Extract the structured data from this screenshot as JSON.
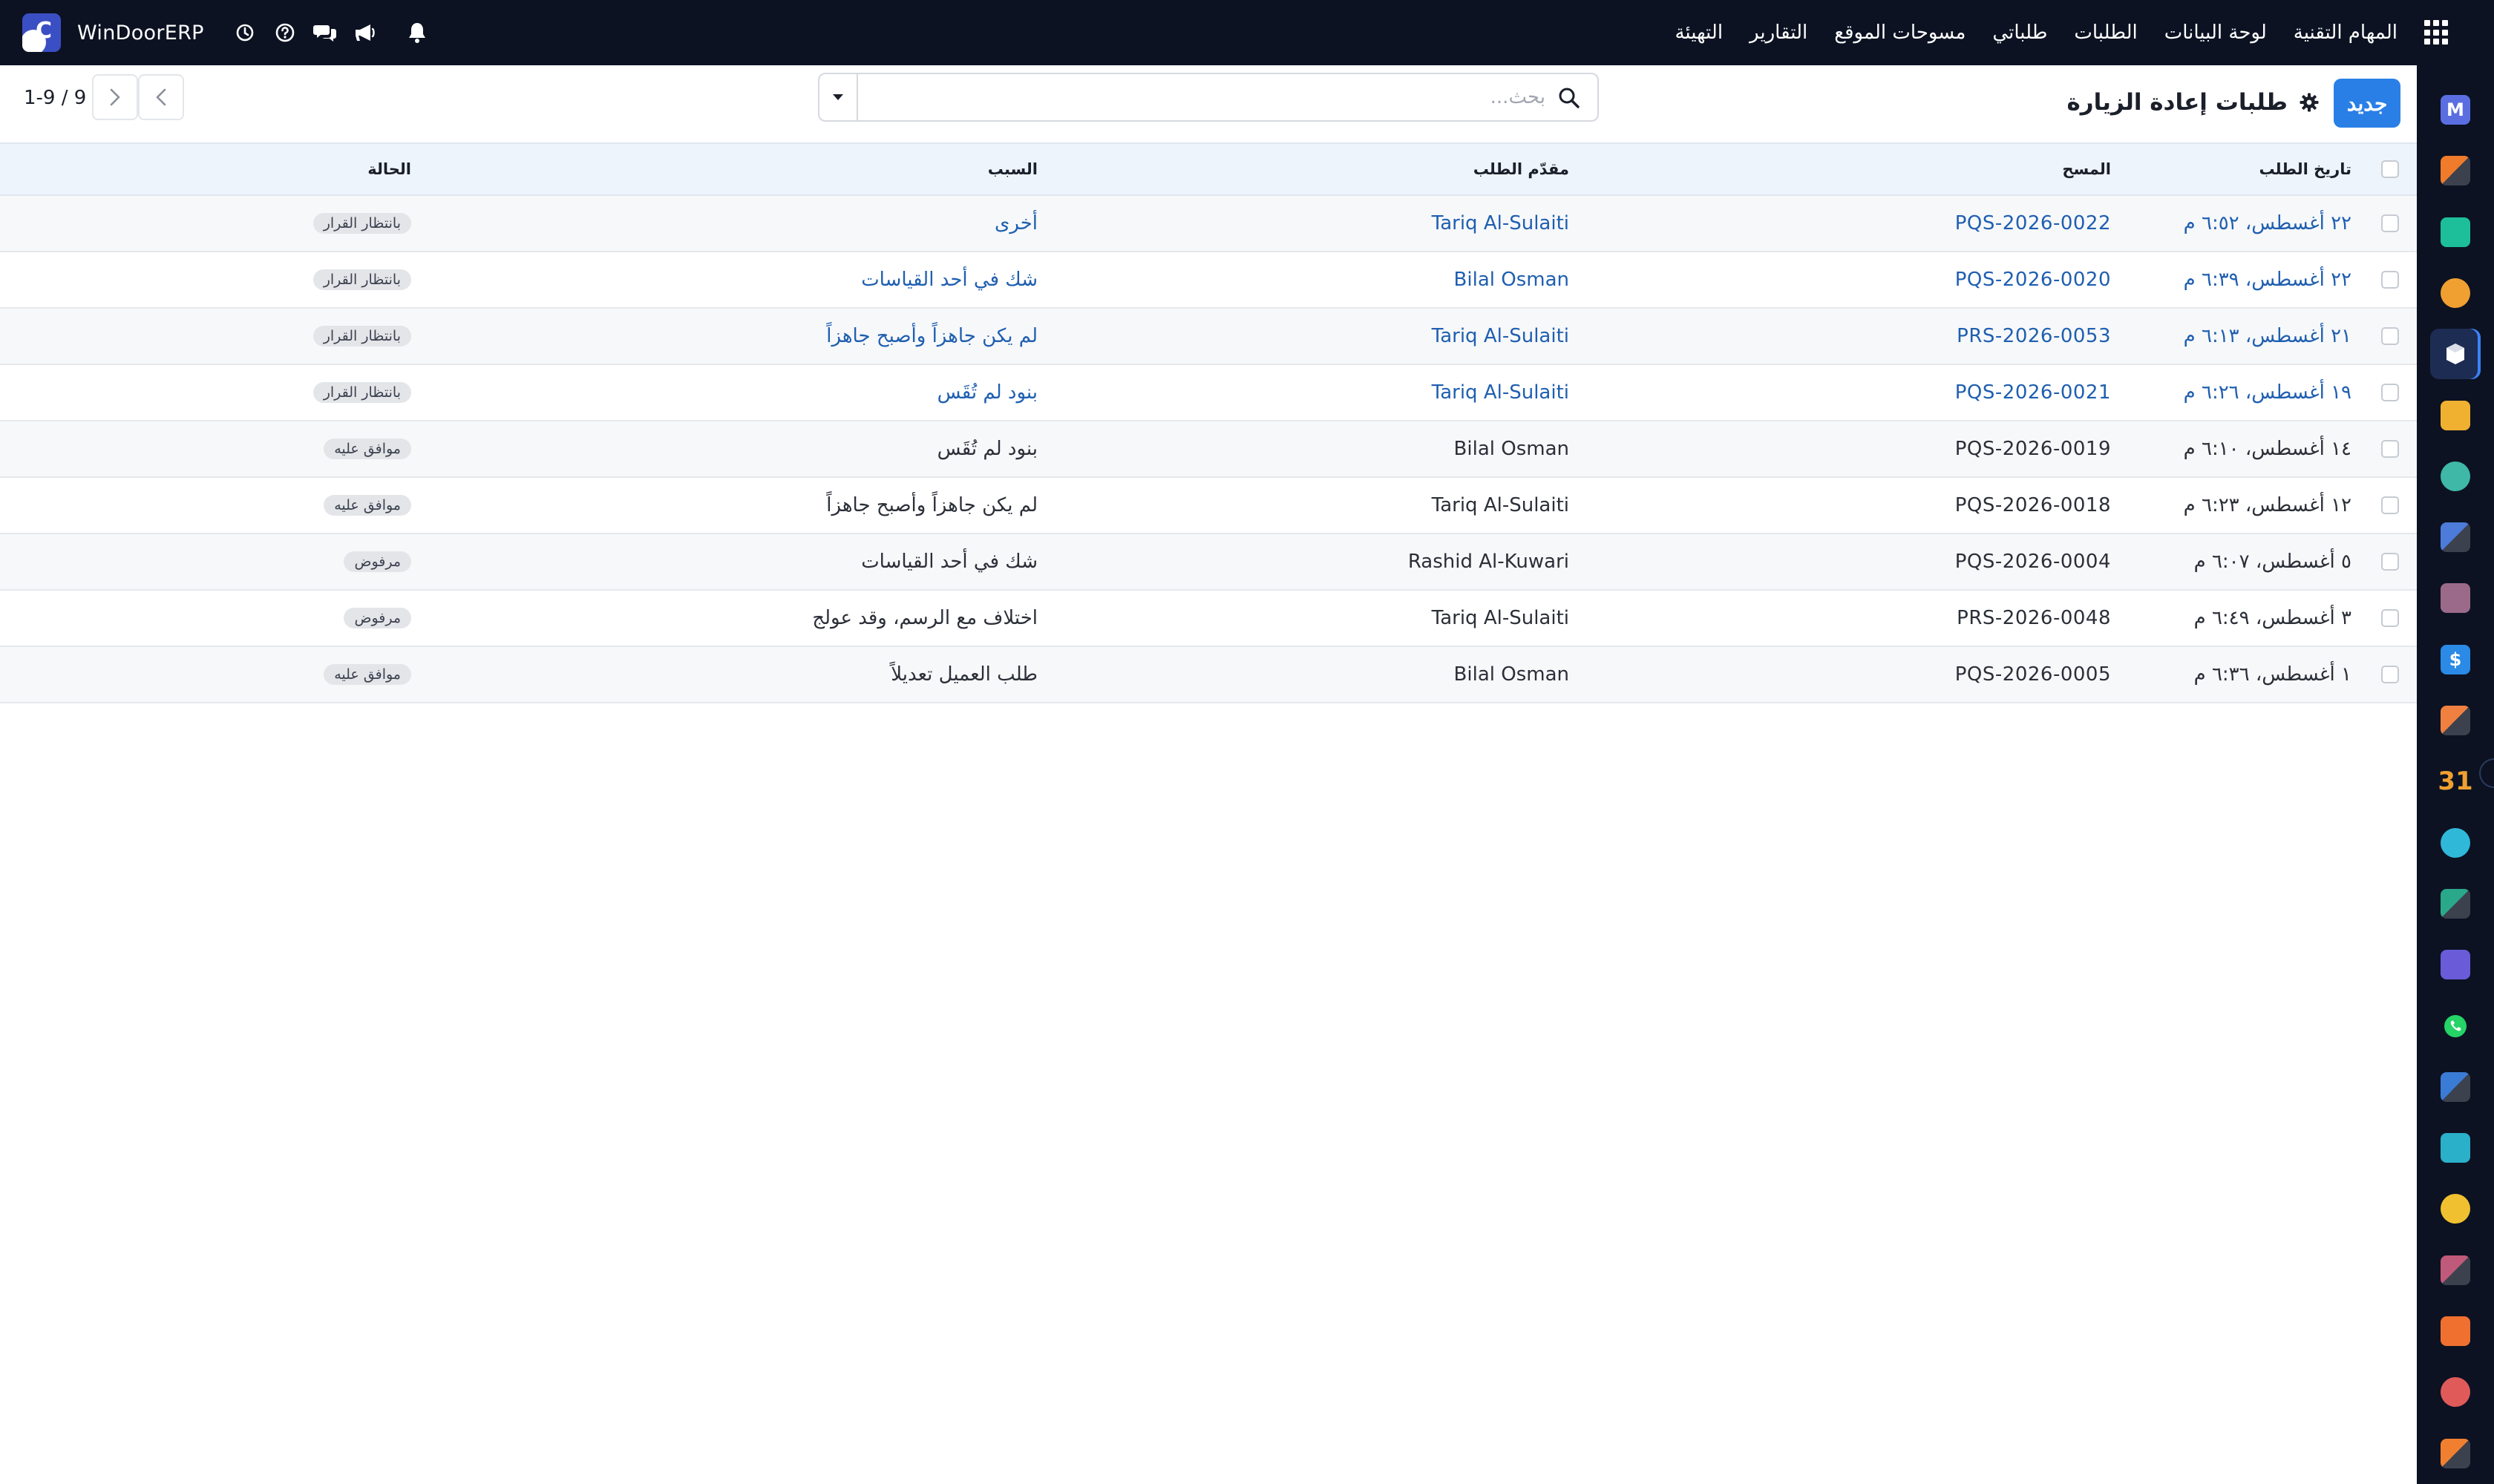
{
  "app": {
    "name": "WinDoorERP"
  },
  "topbar": {
    "menu": [
      "المهام التقنية",
      "لوحة البيانات",
      "الطلبات",
      "طلباتي",
      "مسوحات الموقع",
      "التقارير",
      "التهيئة"
    ]
  },
  "control": {
    "new_label": "جديد",
    "title": "طلبات إعادة الزيارة",
    "search_placeholder": "بحث...",
    "pager": "1-9 / 9"
  },
  "table": {
    "columns": {
      "date": "تاريخ الطلب",
      "survey": "المسح",
      "requester": "مقدّم الطلب",
      "reason": "السبب",
      "status": "الحالة"
    },
    "rows": [
      {
        "date": "٢٢ أغسطس، ٦:٥٢ م",
        "survey": "PQS-2026-0022",
        "requester": "Tariq Al-Sulaiti",
        "reason": "أخرى",
        "status": "بانتظار القرار"
      },
      {
        "date": "٢٢ أغسطس، ٦:٣٩ م",
        "survey": "PQS-2026-0020",
        "requester": "Bilal Osman",
        "reason": "شك في أحد القياسات",
        "status": "بانتظار القرار"
      },
      {
        "date": "٢١ أغسطس، ٦:١٣ م",
        "survey": "PRS-2026-0053",
        "requester": "Tariq Al-Sulaiti",
        "reason": "لم يكن جاهزاً وأصبح جاهزاً",
        "status": "بانتظار القرار"
      },
      {
        "date": "١٩ أغسطس، ٦:٢٦ م",
        "survey": "PQS-2026-0021",
        "requester": "Tariq Al-Sulaiti",
        "reason": "بنود لم تُقَس",
        "status": "بانتظار القرار"
      },
      {
        "date": "١٤ أغسطس، ٦:١٠ م",
        "survey": "PQS-2026-0019",
        "requester": "Bilal Osman",
        "reason": "بنود لم تُقَس",
        "status": "موافق عليه"
      },
      {
        "date": "١٢ أغسطس، ٦:٢٣ م",
        "survey": "PQS-2026-0018",
        "requester": "Tariq Al-Sulaiti",
        "reason": "لم يكن جاهزاً وأصبح جاهزاً",
        "status": "موافق عليه"
      },
      {
        "date": "٥ أغسطس، ٦:٠٧ م",
        "survey": "PQS-2026-0004",
        "requester": "Rashid Al-Kuwari",
        "reason": "شك في أحد القياسات",
        "status": "مرفوض"
      },
      {
        "date": "٣ أغسطس، ٦:٤٩ م",
        "survey": "PRS-2026-0048",
        "requester": "Tariq Al-Sulaiti",
        "reason": "اختلاف مع الرسم، وقد عولج",
        "status": "مرفوض"
      },
      {
        "date": "١ أغسطس، ٦:٣٦ م",
        "survey": "PQS-2026-0005",
        "requester": "Bilal Osman",
        "reason": "طلب العميل تعديلاً",
        "status": "موافق عليه"
      }
    ]
  },
  "dock": {
    "apps": [
      {
        "icon": "mail-app-icon",
        "color": "#5b6ee1",
        "glyph": "M"
      },
      {
        "icon": "discuss-app-icon",
        "color": "#f07b2a",
        "glyph": ""
      },
      {
        "icon": "crm-app-icon",
        "color": "#1dbf9a",
        "glyph": ""
      },
      {
        "icon": "dashboard-app-icon",
        "color": "#f0a030",
        "glyph": ""
      },
      {
        "icon": "windoor-app-icon",
        "color": "#ffffff",
        "glyph": ""
      },
      {
        "icon": "documents-app-icon",
        "color": "#f0b030",
        "glyph": ""
      },
      {
        "icon": "tasks-app-icon",
        "color": "#3fb8a8",
        "glyph": ""
      },
      {
        "icon": "knowledge-app-icon",
        "color": "#4c7bd9",
        "glyph": ""
      },
      {
        "icon": "inventory-app-icon",
        "color": "#9b6a8a",
        "glyph": ""
      },
      {
        "icon": "invoicing-app-icon",
        "color": "#2a8ae6",
        "glyph": "$"
      },
      {
        "icon": "employees-app-icon",
        "color": "#f08040",
        "glyph": ""
      },
      {
        "icon": "calendar-app-icon",
        "color": "#f0a030",
        "glyph": "31"
      },
      {
        "icon": "sign-app-icon",
        "color": "#2fb8d8",
        "glyph": ""
      },
      {
        "icon": "contacts-app-icon",
        "color": "#2aa88a",
        "glyph": ""
      },
      {
        "icon": "website-app-icon",
        "color": "#6a5bd9",
        "glyph": ""
      },
      {
        "icon": "whatsapp-app-icon",
        "color": "#25d366",
        "glyph": ""
      },
      {
        "icon": "timesheets-app-icon",
        "color": "#3a7bd5",
        "glyph": ""
      },
      {
        "icon": "events-app-icon",
        "color": "#2ab0c8",
        "glyph": ""
      },
      {
        "icon": "email-marketing-app-icon",
        "color": "#f0c030",
        "glyph": ""
      },
      {
        "icon": "payroll-app-icon",
        "color": "#c05a7a",
        "glyph": ""
      },
      {
        "icon": "manufacturing-app-icon",
        "color": "#f07030",
        "glyph": ""
      },
      {
        "icon": "reporting-app-icon",
        "color": "#e05a5a",
        "glyph": ""
      },
      {
        "icon": "apps-store-app-icon",
        "color": "#f08030",
        "glyph": ""
      }
    ]
  }
}
